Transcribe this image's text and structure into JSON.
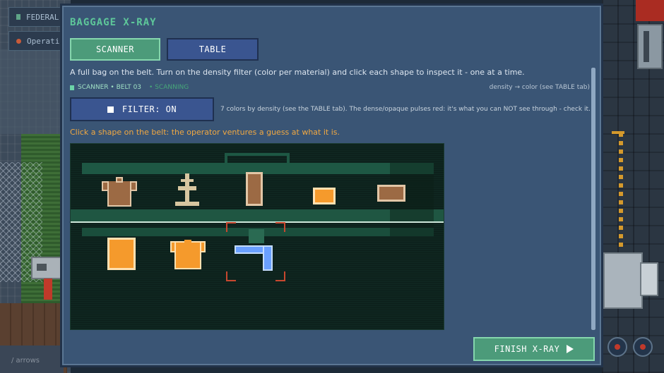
{
  "background": {
    "hud_tags": [
      {
        "label": "FEDERAL",
        "icon": "document-icon"
      },
      {
        "label": "Operati",
        "icon": "gear-icon"
      }
    ],
    "caption": "/ arrows"
  },
  "modal": {
    "title": "BAGGAGE X-RAY",
    "tabs": [
      {
        "label": "SCANNER",
        "active": true
      },
      {
        "label": "TABLE",
        "active": false
      }
    ],
    "intro": "A full bag on the belt. Turn on the density filter (color per material) and click each shape to inspect it - one at a time.",
    "status": {
      "label": "SCANNER • BELT 03",
      "state": "• SCANNING"
    },
    "legend_hint": "density → color (see TABLE tab)",
    "filter": {
      "label": "FILTER: ON",
      "description": "7 colors by density (see the TABLE tab). The dense/opaque pulses red: it's what you can NOT see through - check it."
    },
    "instruction": "Click a shape on the belt: the operator ventures a guess at what it is.",
    "finish_label": "FINISH X-RAY"
  },
  "scanner": {
    "items": [
      {
        "id": "item-1",
        "shape": "shirt",
        "material_color": "#9c6a44",
        "row": "top"
      },
      {
        "id": "item-2",
        "shape": "lamp",
        "material_color": "#d7c6a0",
        "row": "top"
      },
      {
        "id": "item-3",
        "shape": "bar",
        "material_color": "#9c6a44",
        "row": "top"
      },
      {
        "id": "item-4",
        "shape": "small-box",
        "material_color": "#f59a2c",
        "row": "top"
      },
      {
        "id": "item-5",
        "shape": "flat-box",
        "material_color": "#9c6a44",
        "row": "top"
      },
      {
        "id": "item-6",
        "shape": "block",
        "material_color": "#f59a2c",
        "row": "bottom"
      },
      {
        "id": "item-7",
        "shape": "shirt",
        "material_color": "#f59a2c",
        "row": "bottom"
      },
      {
        "id": "item-8",
        "shape": "l-pipe",
        "material_color": "#6aa0ff",
        "row": "bottom",
        "selected": true
      }
    ],
    "colors": {
      "background": "#0f2620",
      "bag": "#1e5844",
      "selection": "#c8472e"
    }
  }
}
